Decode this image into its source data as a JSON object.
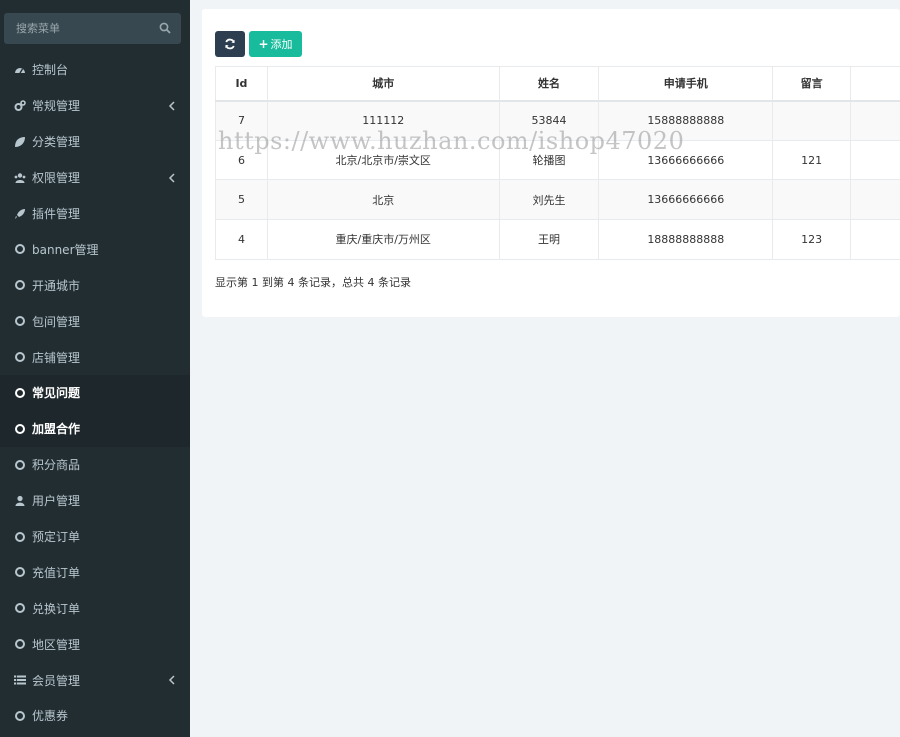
{
  "sidebar": {
    "search_placeholder": "搜索菜单",
    "items": [
      {
        "label": "控制台",
        "icon": "dashboard-icon",
        "has_children": false,
        "active": false
      },
      {
        "label": "常规管理",
        "icon": "cogs-icon",
        "has_children": true,
        "active": false
      },
      {
        "label": "分类管理",
        "icon": "leaf-icon",
        "has_children": false,
        "active": false
      },
      {
        "label": "权限管理",
        "icon": "users-icon",
        "has_children": true,
        "active": false
      },
      {
        "label": "插件管理",
        "icon": "rocket-icon",
        "has_children": false,
        "active": false
      },
      {
        "label": "banner管理",
        "icon": "circle-icon",
        "has_children": false,
        "active": false
      },
      {
        "label": "开通城市",
        "icon": "circle-icon",
        "has_children": false,
        "active": false
      },
      {
        "label": "包间管理",
        "icon": "circle-icon",
        "has_children": false,
        "active": false
      },
      {
        "label": "店铺管理",
        "icon": "circle-icon",
        "has_children": false,
        "active": false
      },
      {
        "label": "常见问题",
        "icon": "circle-icon",
        "has_children": false,
        "active": true
      },
      {
        "label": "加盟合作",
        "icon": "circle-icon",
        "has_children": false,
        "active": true
      },
      {
        "label": "积分商品",
        "icon": "circle-icon",
        "has_children": false,
        "active": false
      },
      {
        "label": "用户管理",
        "icon": "user-icon",
        "has_children": false,
        "active": false
      },
      {
        "label": "预定订单",
        "icon": "circle-icon",
        "has_children": false,
        "active": false
      },
      {
        "label": "充值订单",
        "icon": "circle-icon",
        "has_children": false,
        "active": false
      },
      {
        "label": "兑换订单",
        "icon": "circle-icon",
        "has_children": false,
        "active": false
      },
      {
        "label": "地区管理",
        "icon": "circle-icon",
        "has_children": false,
        "active": false
      },
      {
        "label": "会员管理",
        "icon": "list-icon",
        "has_children": true,
        "active": false
      },
      {
        "label": "优惠券",
        "icon": "circle-icon",
        "has_children": false,
        "active": false
      }
    ]
  },
  "toolbar": {
    "refresh_icon": "refresh-icon",
    "add_label": "添加"
  },
  "table": {
    "headers": [
      "Id",
      "城市",
      "姓名",
      "申请手机",
      "留言",
      ""
    ],
    "rows": [
      [
        "7",
        "111112",
        "53844",
        "15888888888",
        "",
        ""
      ],
      [
        "6",
        "北京/北京市/崇文区",
        "轮播图",
        "13666666666",
        "121",
        ""
      ],
      [
        "5",
        "北京",
        "刘先生",
        "13666666666",
        "",
        ""
      ],
      [
        "4",
        "重庆/重庆市/万州区",
        "王明",
        "18888888888",
        "123",
        ""
      ]
    ]
  },
  "pager": {
    "summary": "显示第 1 到第 4 条记录，总共 4 条记录"
  },
  "watermark": "https://www.huzhan.com/ishop47020",
  "colors": {
    "sidebar_bg": "#222d32",
    "active_bg": "#1e282c",
    "refresh_btn": "#2c3e50",
    "add_btn": "#18bc9c",
    "page_bg": "#f1f4f6"
  }
}
